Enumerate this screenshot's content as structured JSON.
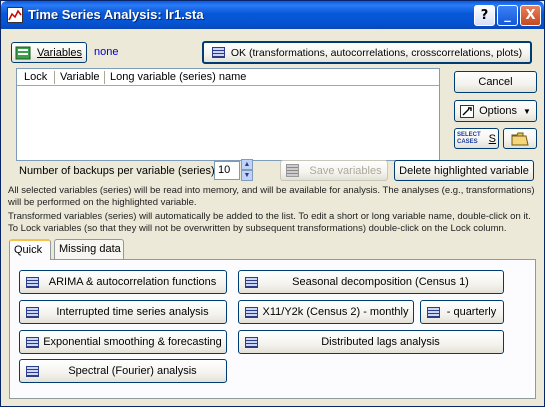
{
  "window": {
    "title": "Time Series Analysis: lr1.sta",
    "help": "?",
    "minimize": "_",
    "close": "X"
  },
  "variables": {
    "button_label": "Variables",
    "selected": "none"
  },
  "ok_button": "OK (transformations, autocorrelations, crosscorrelations, plots)",
  "cancel_button": "Cancel",
  "options_button": "Options",
  "select_cases": {
    "line1": "SELECT",
    "line2": "CASES",
    "symbol": "S"
  },
  "list": {
    "columns": [
      "Lock",
      "Variable",
      "Long variable (series) name"
    ]
  },
  "backups": {
    "label": "Number of backups per variable (series):",
    "value": "10"
  },
  "save_variables_button": "Save variables",
  "delete_button": "Delete highlighted variable",
  "info_lines": [
    "All selected variables (series) will be read into memory, and will be available for analysis. The analyses (e.g., transformations)",
    "will be performed on the highlighted variable.",
    "Transformed variables (series) will automatically be added to the list. To edit a short or long variable name, double-click on it.",
    "To Lock variables (so that they will not be overwritten by subsequent transformations) double-click on the Lock column."
  ],
  "tabs": [
    "Quick",
    "Missing data"
  ],
  "quick": {
    "arima": "ARIMA & autocorrelation functions",
    "interrupted": "Interrupted time series analysis",
    "exponential": "Exponential smoothing & forecasting",
    "spectral": "Spectral (Fourier) analysis",
    "seasonal": "Seasonal decomposition (Census 1)",
    "x11_monthly": "X11/Y2k (Census 2) - monthly",
    "quarterly": "- quarterly",
    "distributed": "Distributed lags analysis"
  }
}
